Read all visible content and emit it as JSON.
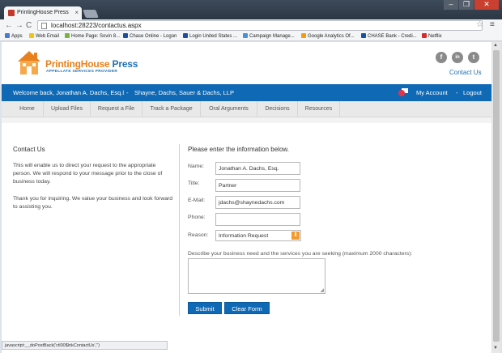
{
  "browser": {
    "tab_title": "PrintingHouse Press",
    "tab_close": "×",
    "window_min": "–",
    "window_max": "❐",
    "window_close": "✕",
    "url": "localhost:28223/contactus.aspx",
    "back": "←",
    "forward": "→",
    "reload": "C",
    "star": "☆",
    "menu": "≡",
    "bookmarks": [
      {
        "label": "Apps",
        "color": "#4a7bd0"
      },
      {
        "label": "Web Email",
        "color": "#f1c40f"
      },
      {
        "label": "Home Page: Sovin 8...",
        "color": "#7bb342"
      },
      {
        "label": "Chase Online - Logon",
        "color": "#1c4f9c"
      },
      {
        "label": "Login United States ...",
        "color": "#1c4f9c"
      },
      {
        "label": "Campaign Manage...",
        "color": "#4a90d9"
      },
      {
        "label": "Google Analytics Of...",
        "color": "#f39c12"
      },
      {
        "label": "CHASE Bank - Credi...",
        "color": "#1c4f9c"
      },
      {
        "label": "Netflix",
        "color": "#d62b2b"
      }
    ],
    "status_text": "javascript:__doPostBack('ctl00$lnkContactUs','')"
  },
  "header": {
    "logo_word1": "PrintingHouse",
    "logo_word2": " Press",
    "logo_sub": "APPELLATE SERVICES PROVIDER",
    "social": [
      {
        "icon": "facebook-icon",
        "glyph": "f"
      },
      {
        "icon": "linkedin-icon",
        "glyph": "in"
      },
      {
        "icon": "twitter-icon",
        "glyph": "t"
      }
    ],
    "contact_link": "Contact Us"
  },
  "userbar": {
    "welcome": "Welcome back, Jonathan A. Dachs, Esq.l",
    "separator": "-",
    "firm": "Shayne, Dachs, Sauer & Dachs, LLP",
    "my_account": "My Account",
    "separator2": "-",
    "logout": "Logout"
  },
  "nav": {
    "tabs": [
      "Home",
      "Upload Files",
      "Request a File",
      "Track a Package",
      "Oral Arguments",
      "Decisions",
      "Resources"
    ]
  },
  "left": {
    "heading": "Contact Us",
    "para1": "This will enable us to direct your request to the appropriate person. We will respond to your message prior to the close of business today.",
    "para2": "Thank you for inquiring. We value your business and look forward to assisting you."
  },
  "form": {
    "heading": "Please enter the information below.",
    "name_label": "Name:",
    "name_value": "Jonathan  A. Dachs, Esq.",
    "title_label": "Title:",
    "title_value": "Partner",
    "email_label": "E-Mail:",
    "email_value": "jdachs@shaynedachs.com",
    "phone_label": "Phone:",
    "phone_value": "",
    "reason_label": "Reason:",
    "reason_value": "Information Request",
    "reason_arrow": "⬇",
    "describe_label": "Describe your business need and the services you are seeking (maximum 2000 characters):",
    "submit_label": "Submit",
    "clear_label": "Clear Form"
  },
  "colors": {
    "brand_blue": "#0f69b4",
    "brand_orange": "#e8801e"
  }
}
